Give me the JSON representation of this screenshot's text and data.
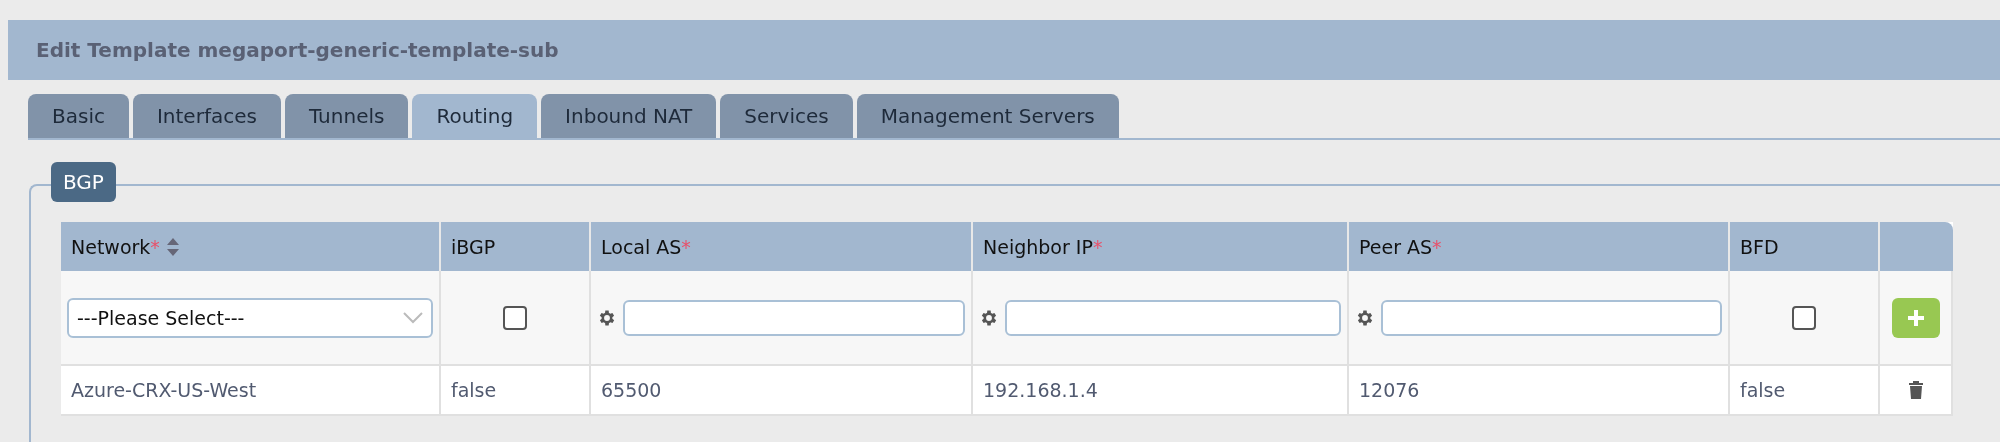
{
  "window": {
    "title": "Edit Template megaport-generic-template-sub"
  },
  "tabs": [
    {
      "label": "Basic",
      "selected": false
    },
    {
      "label": "Interfaces",
      "selected": false
    },
    {
      "label": "Tunnels",
      "selected": false
    },
    {
      "label": "Routing",
      "selected": true
    },
    {
      "label": "Inbound NAT",
      "selected": false
    },
    {
      "label": "Services",
      "selected": false
    },
    {
      "label": "Management Servers",
      "selected": false
    }
  ],
  "section": {
    "legend": "BGP"
  },
  "table": {
    "columns": [
      {
        "label": "Network",
        "required_mark": "*",
        "sortable": true
      },
      {
        "label": "iBGP",
        "sortable": false
      },
      {
        "label": "Local AS",
        "required_mark": "*",
        "sortable": false
      },
      {
        "label": "Neighbor IP",
        "required_mark": "*",
        "sortable": false
      },
      {
        "label": "Peer AS",
        "required_mark": "*",
        "sortable": false
      },
      {
        "label": "BFD",
        "sortable": false
      }
    ],
    "input_row": [
      {
        "kind": "select",
        "placeholder": "---Please Select---"
      },
      {
        "kind": "checkbox",
        "checked": false
      },
      {
        "kind": "text"
      },
      {
        "kind": "text"
      },
      {
        "kind": "text"
      },
      {
        "kind": "checkbox",
        "checked": false
      }
    ],
    "rows": [
      {
        "cells": [
          "Azure-CRX-US-West",
          "false",
          "65500",
          "192.168.1.4",
          "12076",
          "false"
        ]
      }
    ]
  }
}
